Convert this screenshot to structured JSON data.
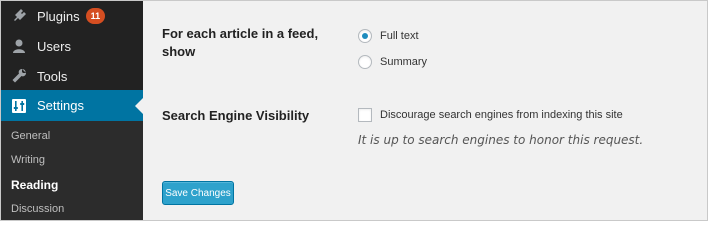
{
  "sidebar": {
    "items": [
      {
        "label": "Plugins",
        "icon": "plug-icon",
        "badge": "11"
      },
      {
        "label": "Users",
        "icon": "users-icon"
      },
      {
        "label": "Tools",
        "icon": "wrench-icon"
      },
      {
        "label": "Settings",
        "icon": "settings-icon",
        "active": true
      }
    ],
    "submenu": [
      {
        "label": "General"
      },
      {
        "label": "Writing"
      },
      {
        "label": "Reading",
        "current": true
      },
      {
        "label": "Discussion"
      }
    ]
  },
  "reading": {
    "feed_article_label": "For each article in a feed, show",
    "feed_options": [
      {
        "label": "Full text",
        "checked": true
      },
      {
        "label": "Summary",
        "checked": false
      }
    ],
    "search_visibility_label": "Search Engine Visibility",
    "discourage_label": "Discourage search engines from indexing this site",
    "discourage_checked": false,
    "search_note": "It is up to search engines to honor this request."
  },
  "actions": {
    "save_label": "Save Changes"
  },
  "colors": {
    "sidebar_bg": "#222222",
    "active_bg": "#0074a2",
    "badge_bg": "#d54e21",
    "button_bg": "#2ea2cc",
    "content_bg": "#f1f1f1"
  }
}
